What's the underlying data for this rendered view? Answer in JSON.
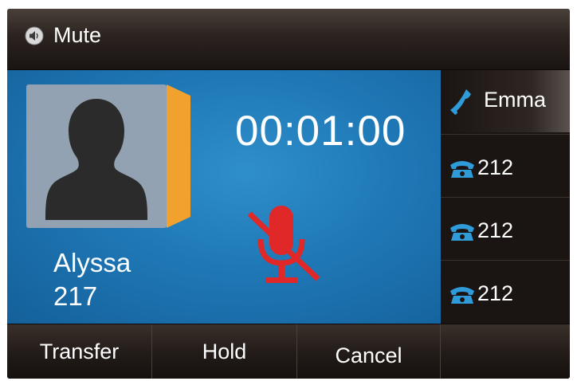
{
  "status_bar": {
    "mute_label": "Mute"
  },
  "call": {
    "caller_name": "Alyssa",
    "caller_number": "217",
    "timer": "00:01:00",
    "mic_muted": true
  },
  "lines": [
    {
      "label": "Emma",
      "icon": "handset-icon",
      "active": true
    },
    {
      "label": "212",
      "icon": "desk-phone-icon",
      "active": false
    },
    {
      "label": "212",
      "icon": "desk-phone-icon",
      "active": false
    },
    {
      "label": "212",
      "icon": "desk-phone-icon",
      "active": false
    }
  ],
  "softkeys": [
    "Transfer",
    "Hold",
    "Cancel",
    ""
  ],
  "colors": {
    "screen_blue": "#1f78b6",
    "accent_orange": "#f0a12e",
    "mute_red": "#e02828",
    "line_icon_blue": "#2f9bd8"
  }
}
